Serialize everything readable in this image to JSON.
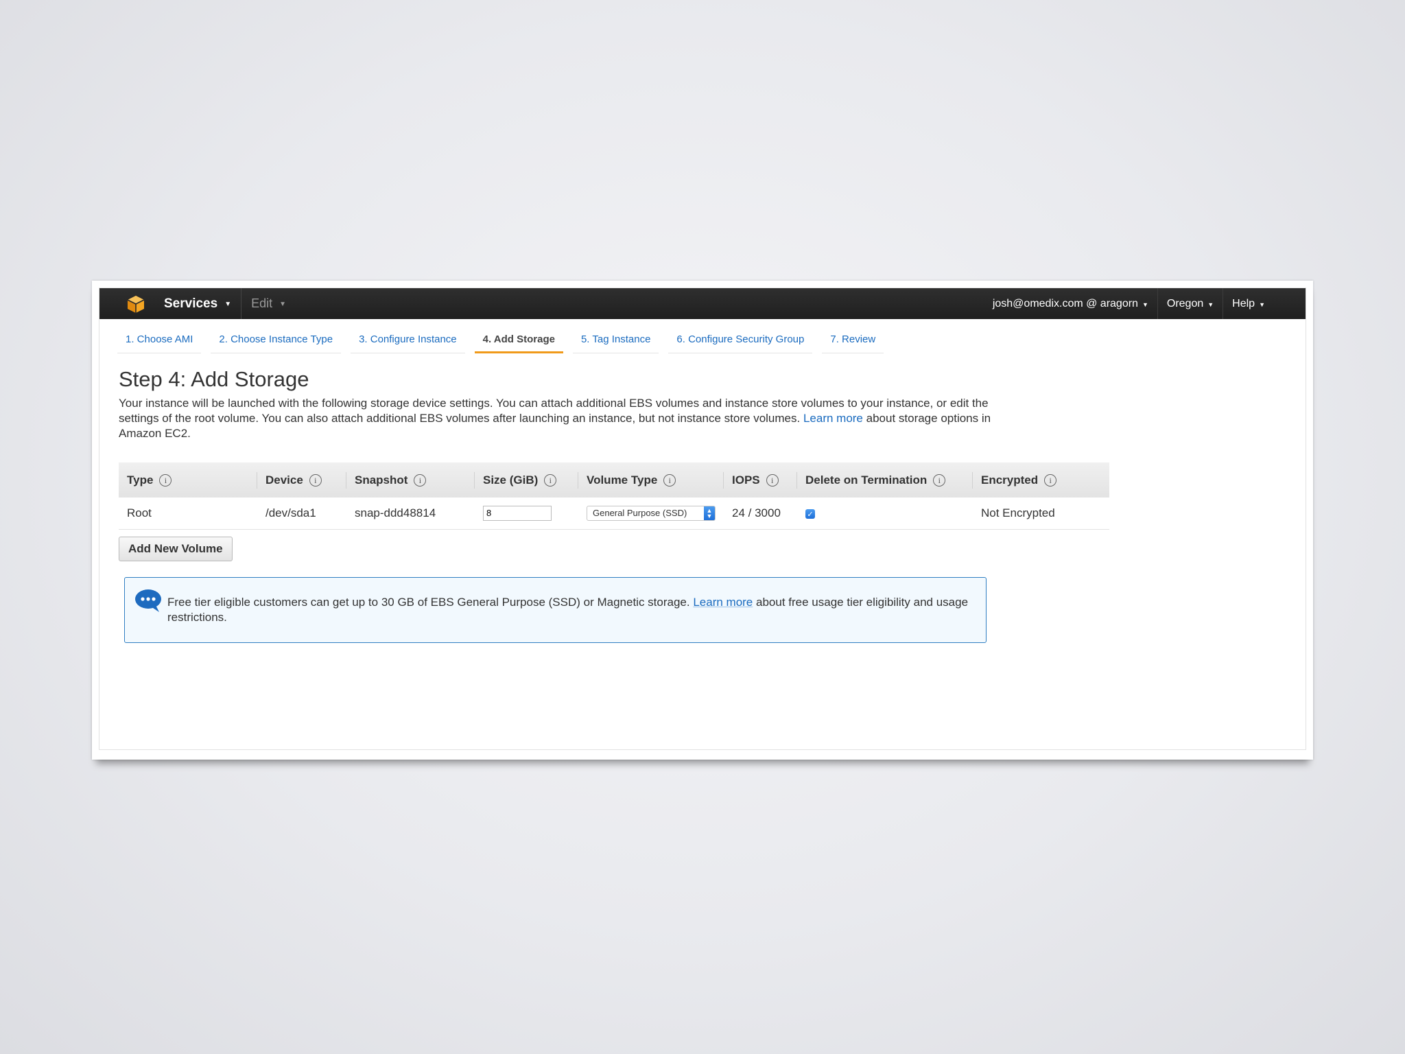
{
  "nav": {
    "services_label": "Services",
    "edit_label": "Edit",
    "account_label": "josh@omedix.com @ aragorn",
    "region_label": "Oregon",
    "help_label": "Help"
  },
  "tabs": [
    {
      "label": "1. Choose AMI"
    },
    {
      "label": "2. Choose Instance Type"
    },
    {
      "label": "3. Configure Instance"
    },
    {
      "label": "4. Add Storage"
    },
    {
      "label": "5. Tag Instance"
    },
    {
      "label": "6. Configure Security Group"
    },
    {
      "label": "7. Review"
    }
  ],
  "page": {
    "title": "Step 4: Add Storage",
    "description": "Your instance will be launched with the following storage device settings. You can attach additional EBS volumes and instance store volumes to your instance, or edit the settings of the root volume. You can also attach additional EBS volumes after launching an instance, but not instance store volumes.",
    "learn_more": "Learn more",
    "description_suffix": "about storage options in Amazon EC2."
  },
  "table": {
    "headers": [
      "Type",
      "Device",
      "Snapshot",
      "Size (GiB)",
      "Volume Type",
      "IOPS",
      "Delete on Termination",
      "Encrypted"
    ],
    "row": {
      "type": "Root",
      "device": "/dev/sda1",
      "snapshot": "snap-ddd48814",
      "size": "8",
      "volume_type": "General Purpose (SSD)",
      "iops": "24 / 3000",
      "delete_on_termination": true,
      "encrypted": "Not Encrypted"
    }
  },
  "add_volume_label": "Add New Volume",
  "notice": {
    "text": "Free tier eligible customers can get up to 30 GB of EBS General Purpose (SSD) or Magnetic storage.",
    "learn_more": "Learn more",
    "text_suffix": "about free usage tier eligibility and usage restrictions."
  },
  "colors": {
    "nav_bg": "#232323",
    "link": "#1a6bbf",
    "active_tab_underline": "#f09a1a",
    "notice_border": "#2f7ec2",
    "logo_orange": "#f5a623"
  },
  "icons": {
    "logo": "aws-cube-icon",
    "info": "info-icon",
    "notice": "chat-bubble-icon"
  }
}
